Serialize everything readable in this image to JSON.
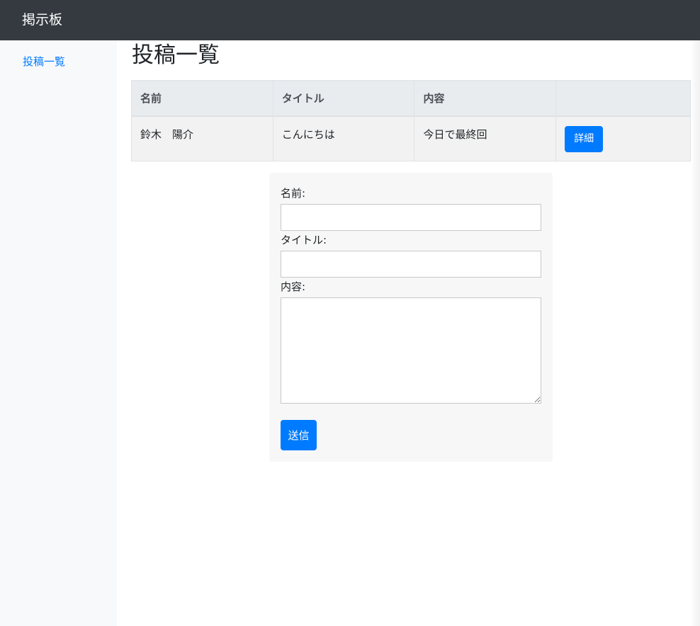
{
  "navbar": {
    "brand": "掲示板"
  },
  "sidebar": {
    "items": [
      {
        "label": "投稿一覧"
      }
    ]
  },
  "main": {
    "title": "投稿一覧",
    "table": {
      "headers": [
        "名前",
        "タイトル",
        "内容",
        ""
      ],
      "rows": [
        {
          "name": "鈴木　陽介",
          "title": "こんにちは",
          "content": "今日で最終回",
          "action": "詳細"
        }
      ]
    },
    "form": {
      "name_label": "名前:",
      "name_value": "",
      "title_label": "タイトル:",
      "title_value": "",
      "content_label": "内容:",
      "content_value": "",
      "submit_label": "送信"
    }
  },
  "colors": {
    "navbar_bg": "#343a40",
    "sidebar_bg": "#f8f9fa",
    "link": "#007bff",
    "primary_button": "#007bff"
  }
}
